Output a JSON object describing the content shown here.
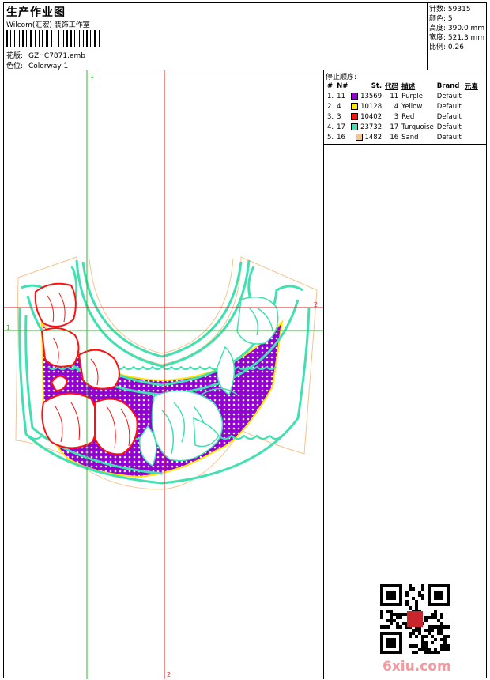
{
  "header": {
    "title": "生产作业图",
    "company": "Wilcom(汇宏) 装饰工作室",
    "design_label": "花版:",
    "design_value": "GZHC7871.emb",
    "colorway_label": "色位:",
    "colorway_value": "Colorway 1"
  },
  "stats": [
    {
      "label": "针数:",
      "value": "59315"
    },
    {
      "label": "颜色:",
      "value": "5"
    },
    {
      "label": "高度:",
      "value": "390.0 mm"
    },
    {
      "label": "宽度:",
      "value": "521.3 mm"
    },
    {
      "label": "比例:",
      "value": "0.26"
    }
  ],
  "stop_sequence": {
    "title": "停止顺序:",
    "headers": [
      "#",
      "N#",
      "St.",
      "代码",
      "描述",
      "Brand",
      "元素"
    ],
    "rows": [
      {
        "idx": "1.",
        "n": "11",
        "color": "#9400d3",
        "st": "13569",
        "code": "11",
        "desc": "Purple",
        "brand": "Default"
      },
      {
        "idx": "2.",
        "n": "4",
        "color": "#ffe600",
        "st": "10128",
        "code": "4",
        "desc": "Yellow",
        "brand": "Default"
      },
      {
        "idx": "3.",
        "n": "3",
        "color": "#ff1010",
        "st": "10402",
        "code": "3",
        "desc": "Red",
        "brand": "Default"
      },
      {
        "idx": "4.",
        "n": "17",
        "color": "#40e0b0",
        "st": "23732",
        "code": "17",
        "desc": "Turquoise",
        "brand": "Default"
      },
      {
        "idx": "5.",
        "n": "16",
        "color": "#f5c48c",
        "st": "1482",
        "code": "16",
        "desc": "Sand",
        "brand": "Default"
      }
    ]
  },
  "guides": {
    "green_v": "1",
    "green_h": "1",
    "red_h": "2",
    "red_v": "2"
  },
  "watermark": "6xiu.com",
  "colors": {
    "purple": "#9400d3",
    "yellow": "#ffe600",
    "red": "#ff1010",
    "turquoise": "#40e0b0",
    "sand": "#f5c48c",
    "guide_green": "#2bb82b",
    "guide_red": "#d42020"
  }
}
